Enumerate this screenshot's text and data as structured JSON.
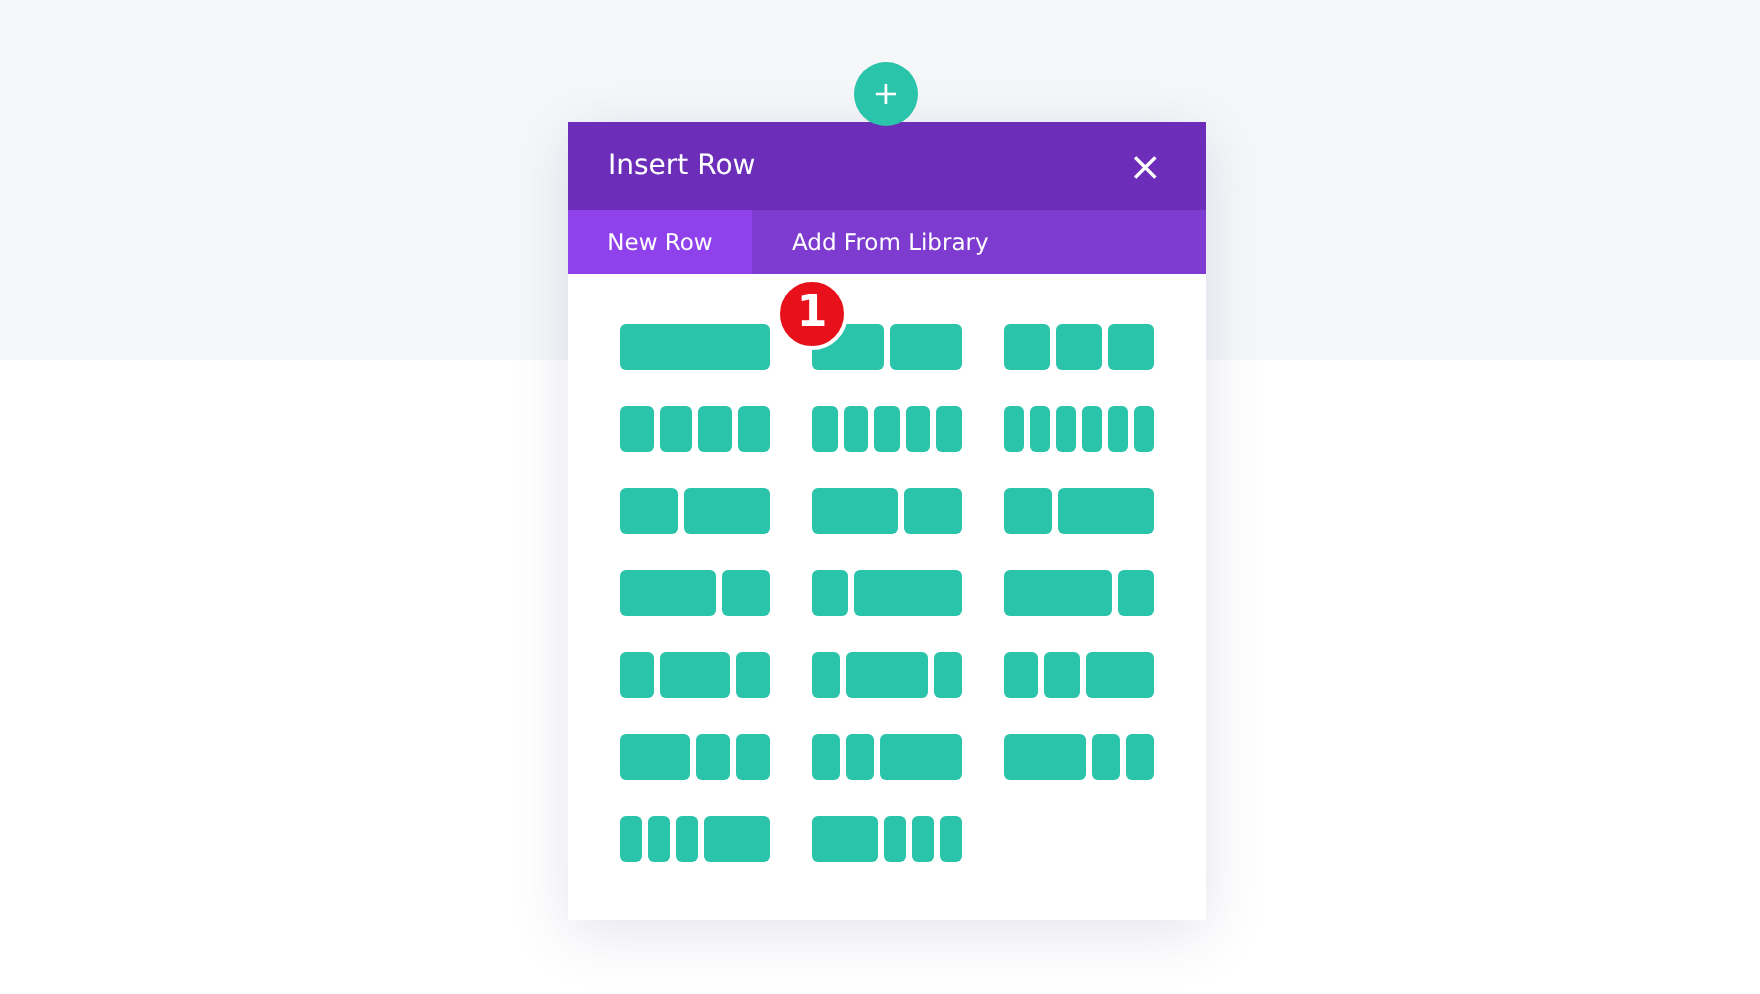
{
  "add_button": {
    "label": "+"
  },
  "modal": {
    "title": "Insert Row",
    "close": "×",
    "tabs": [
      {
        "label": "New Row",
        "selected": true
      },
      {
        "label": "Add From Library",
        "selected": false
      }
    ],
    "step_badge": "1",
    "row_layouts": [
      {
        "kind": "full"
      },
      {
        "kind": "halves"
      },
      {
        "kind": "thirds"
      },
      {
        "kind": "quarters"
      },
      {
        "kind": "fifths"
      },
      {
        "kind": "sixths"
      },
      {
        "kind": "narrow_wide"
      },
      {
        "kind": "wide_narrow"
      },
      {
        "kind": "third_twothirds"
      },
      {
        "kind": "twothirds_third"
      },
      {
        "kind": "quarter_threequarters"
      },
      {
        "kind": "threequarters_quarter"
      },
      {
        "kind": "quarter_half_quarter"
      },
      {
        "kind": "fifth_threefifths_fifth"
      },
      {
        "kind": "quarter_quarter_half"
      },
      {
        "kind": "half_quarter_quarter"
      },
      {
        "kind": "fifth_fifth_threefifths"
      },
      {
        "kind": "threefifths_fifth_fifth"
      },
      {
        "kind": "sixth_sixth_sixth_half"
      },
      {
        "kind": "half_sixth_sixth_sixth"
      }
    ]
  }
}
